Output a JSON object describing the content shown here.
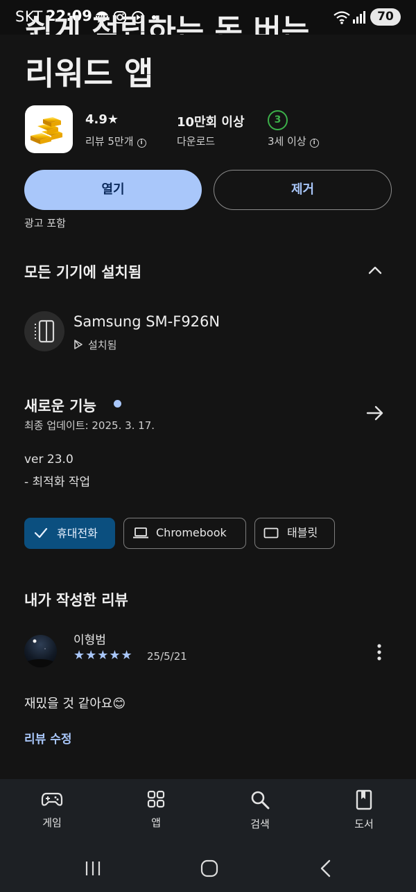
{
  "status_bar": {
    "carrier": "SKT",
    "time": "22:09",
    "battery": "70"
  },
  "app": {
    "title_cut": "쉽게 적립하는 돈 버는",
    "title": "리워드 앱",
    "rating": "4.9★",
    "reviews": "리뷰 5만개",
    "downloads": "10만회 이상",
    "downloads_label": "다운로드",
    "age_rating": "3",
    "age_label": "3세 이상"
  },
  "actions": {
    "open": "열기",
    "remove": "제거",
    "ads": "광고 포함"
  },
  "devices": {
    "title": "모든 기기에 설치됨",
    "name": "Samsung SM-F926N",
    "status": "설치됨"
  },
  "whats_new": {
    "title": "새로운 기능",
    "updated": "최종 업데이트: 2025. 3. 17.",
    "version": "ver 23.0",
    "note": "- 최적화 작업"
  },
  "device_chips": [
    {
      "label": "휴대전화",
      "selected": true
    },
    {
      "label": "Chromebook",
      "selected": false
    },
    {
      "label": "태블릿",
      "selected": false
    }
  ],
  "my_review": {
    "title": "내가 작성한 리뷰",
    "reviewer": "이형범",
    "stars": "★★★★★",
    "star_count": 5,
    "date": "25/5/21",
    "text": "재밌을 것 같아요😊",
    "edit": "리뷰 수정"
  },
  "bottom_nav": [
    {
      "label": "게임",
      "icon": "gamepad-icon"
    },
    {
      "label": "앱",
      "icon": "apps-grid-icon"
    },
    {
      "label": "검색",
      "icon": "search-icon"
    },
    {
      "label": "도서",
      "icon": "book-icon"
    }
  ],
  "colors": {
    "background": "#141414",
    "accent": "#a9c7fa",
    "chip_selected": "#0b4f7f",
    "age_green": "#3cb04a",
    "nav_bg": "#1d2024"
  }
}
